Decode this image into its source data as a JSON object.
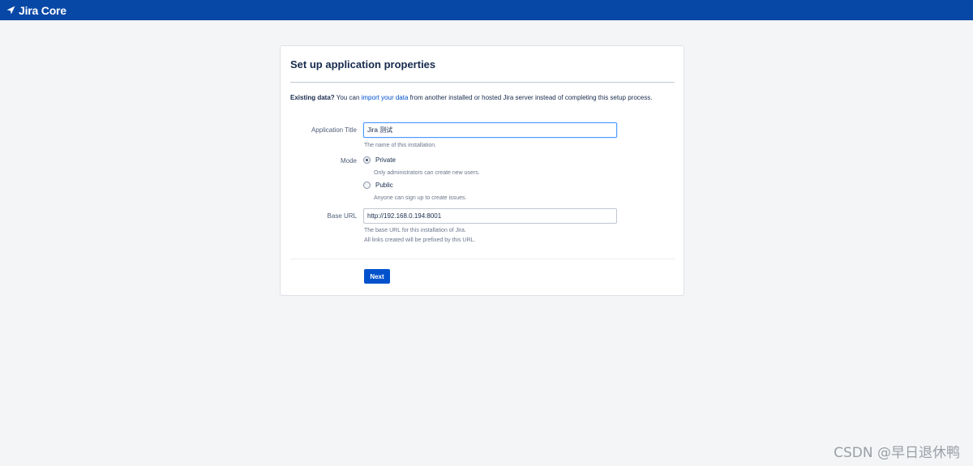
{
  "header": {
    "app_name": "Jira Core",
    "brand_color": "#0747a6",
    "logo_icon": "jira-arrow-icon"
  },
  "panel": {
    "title": "Set up application properties",
    "intro": {
      "bold": "Existing data?",
      "before_link": " You can ",
      "link": "import your data",
      "after_link": " from another installed or hosted Jira server instead of completing this setup process."
    },
    "application_title": {
      "label": "Application Title",
      "value": "Jira 测试",
      "hint": "The name of this installation."
    },
    "mode": {
      "label": "Mode",
      "options": [
        {
          "label": "Private",
          "hint": "Only administrators can create new users.",
          "checked": true
        },
        {
          "label": "Public",
          "hint": "Anyone can sign up to create issues.",
          "checked": false
        }
      ]
    },
    "base_url": {
      "label": "Base URL",
      "value": "http://192.168.0.194:8001",
      "hint_line1": "The base URL for this installation of Jira.",
      "hint_line2": "All links created will be prefixed by this URL."
    },
    "next_label": "Next",
    "button_color": "#0052cc"
  },
  "watermark": "CSDN @早日退休鸭"
}
